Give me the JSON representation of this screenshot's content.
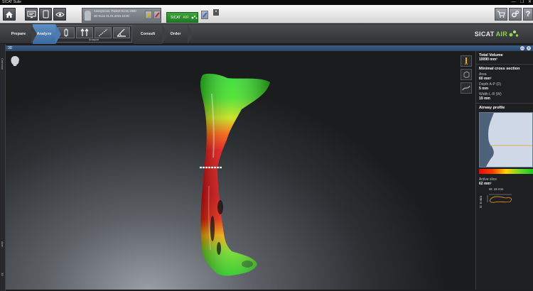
{
  "titlebar": {
    "title": "SICAT Suite",
    "controls": [
      "—",
      "❐",
      "✕"
    ]
  },
  "toolbar": {
    "home_icon": "home-icon",
    "patient": {
      "name_line": "Anonymous, Patient  01.01.1900",
      "scan_line": "3D Scan  01.01.2015  10:00"
    },
    "app_tab_label": "SICAT",
    "app_tab_accent": "AIR",
    "small_close": "×"
  },
  "workflow": {
    "steps": [
      {
        "label": "Prepare"
      },
      {
        "label": "Analyze"
      },
      {
        "label": "Consult"
      },
      {
        "label": "Order"
      }
    ],
    "tools_label": "Analyze",
    "logo_main": "SICAT",
    "logo_accent": "AIR"
  },
  "view": {
    "title": "3D",
    "side_label_top": "Common",
    "side_label_mid": "Airw",
    "side_label_bot": "3D"
  },
  "panel": {
    "total_volume_title": "Total Volume",
    "total_volume_value": "10090 mm³",
    "min_cross_title": "Minimal cross section",
    "area_label": "Area",
    "area_value": "60 mm²",
    "depth_label": "Depth A-P (D)",
    "depth_value": "5 mm",
    "width_label": "Width L-R (W)",
    "width_value": "19 mm",
    "profile_title": "Airway profile",
    "active_slice_label": "Active slice",
    "active_slice_value": "62 mm²",
    "slice_width_label": "W: 19 mm",
    "slice_depth_label": "D: 6 mm"
  },
  "colors": {
    "accent_blue": "#3a6aa0",
    "brand_green": "#8ed14a",
    "heat_red": "#e01010",
    "heat_green": "#18c81e"
  }
}
